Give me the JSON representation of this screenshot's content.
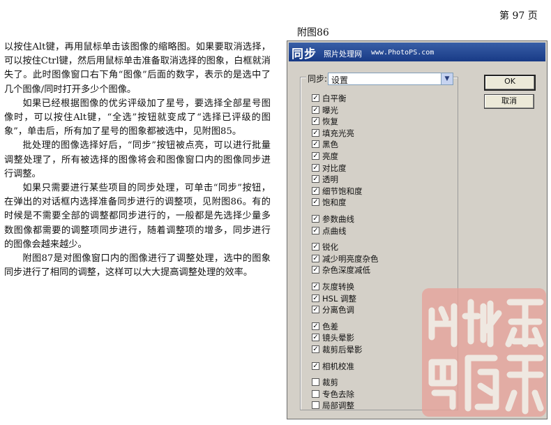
{
  "page_number": "第 97 页",
  "paragraphs": [
    {
      "indent": false,
      "text": "以按住Alt键，再用鼠标单击该图像的缩略图。如果要取消选择，可以按住Ctrl键，然后用鼠标单击准备取消选择的图象，白框就消失了。此时图像窗口右下角“图像”后面的数字，表示的是选中了几个图像/同时打开多少个图像。"
    },
    {
      "indent": true,
      "text": "如果已经根据图像的优劣评级加了星号，要选择全部星号图像时，可以按住Alt键，“全选”按钮就变成了“选择已评级的图象”，单击后，所有加了星号的图象都被选中，见附图85。"
    },
    {
      "indent": true,
      "text": "批处理的图像选择好后，“同步”按钮被点亮，可以进行批量调整处理了，所有被选择的图像将会和图像窗口内的图像同步进行调整。"
    },
    {
      "indent": true,
      "text": "如果只需要进行某些项目的同步处理，可单击“同步”按钮，在弹出的对话框内选择准备同步进行的调整项，见附图86。有的时候是不需要全部的调整都同步进行的，一般都是先选择少量多数图像都需要的调整项同步进行，随着调整项的增多，同步进行的图像会越来越少。"
    },
    {
      "indent": true,
      "text": "附图87是对图像窗口内的图像进行了调整处理，选中的图象同步进行了相同的调整，这样可以大大提高调整处理的效率。"
    }
  ],
  "figure_caption": "附图86",
  "dialog": {
    "title": "同步",
    "subtitle": "照片处理网",
    "url": "www.PhotoPS.com",
    "sync_label": "同步:",
    "sync_value": "设置",
    "ok_label": "OK",
    "cancel_label": "取消",
    "checkboxes": [
      {
        "label": "白平衡",
        "checked": true
      },
      {
        "label": "曝光",
        "checked": true
      },
      {
        "label": "恢复",
        "checked": true
      },
      {
        "label": "填充光亮",
        "checked": true
      },
      {
        "label": "黑色",
        "checked": true
      },
      {
        "label": "亮度",
        "checked": true
      },
      {
        "label": "对比度",
        "checked": true
      },
      {
        "label": "透明",
        "checked": true
      },
      {
        "label": "细节饱和度",
        "checked": true
      },
      {
        "label": "饱和度",
        "checked": true
      },
      {
        "label": "参数曲线",
        "checked": true
      },
      {
        "label": "点曲线",
        "checked": true
      },
      {
        "label": "锐化",
        "checked": true
      },
      {
        "label": "减少明亮度杂色",
        "checked": true
      },
      {
        "label": "杂色深度减低",
        "checked": true
      },
      {
        "label": "灰度转换",
        "checked": true
      },
      {
        "label": "HSL 调整",
        "checked": true
      },
      {
        "label": "分离色调",
        "checked": true
      },
      {
        "label": "色差",
        "checked": true
      },
      {
        "label": "镜头晕影",
        "checked": true
      },
      {
        "label": "裁剪后晕影",
        "checked": true
      },
      {
        "label": "相机校准",
        "checked": true
      },
      {
        "label": "裁剪",
        "checked": false
      },
      {
        "label": "专色去除",
        "checked": false
      },
      {
        "label": "局部调整",
        "checked": false
      }
    ]
  },
  "watermark_seal": "seal-stamp"
}
